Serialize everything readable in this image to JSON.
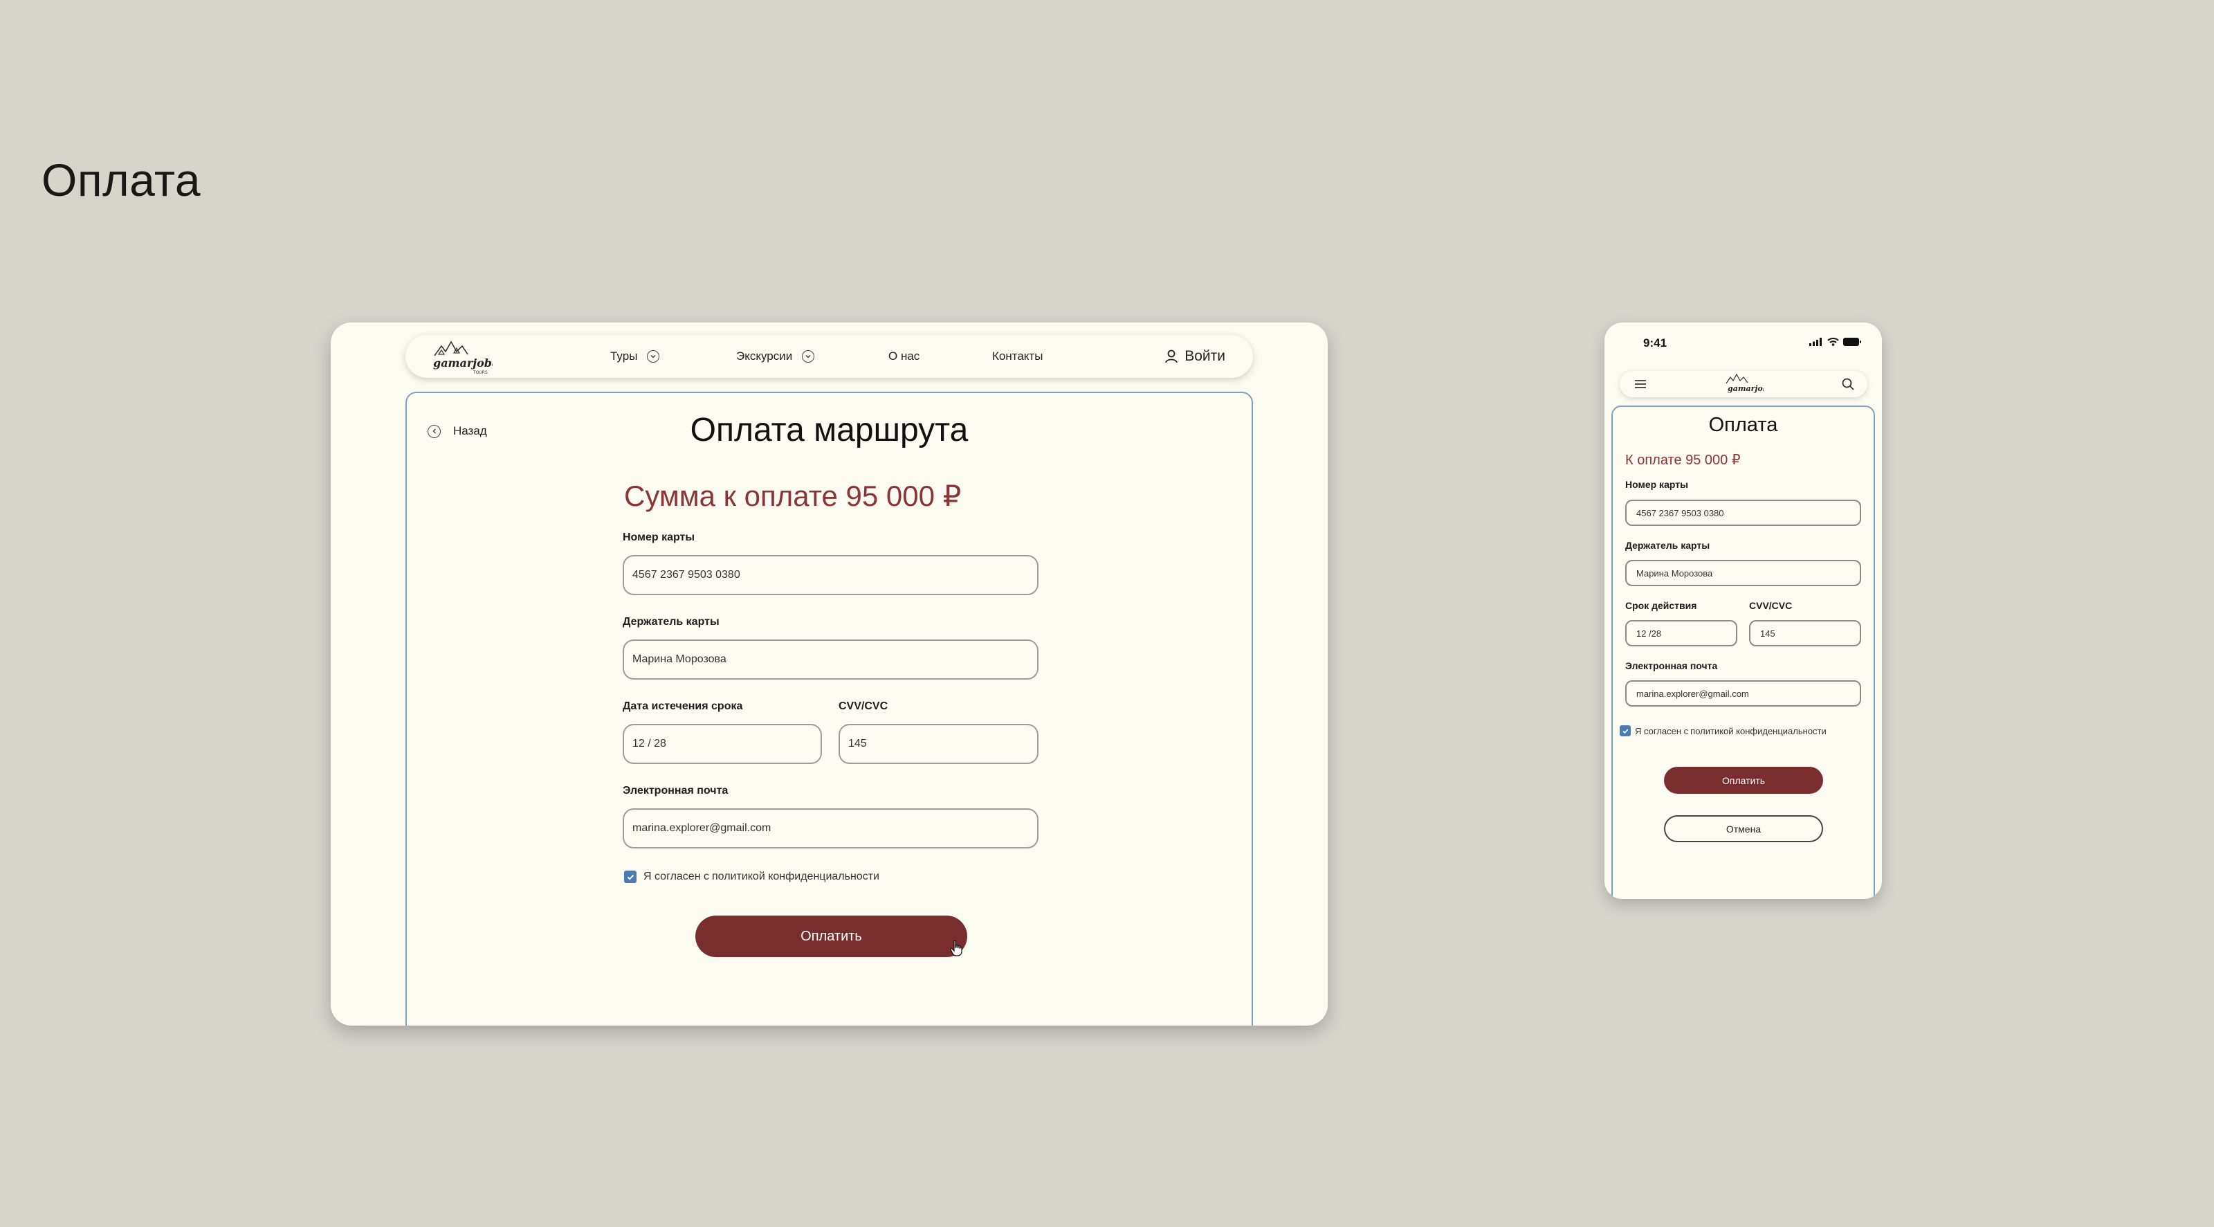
{
  "slide": {
    "title": "Оплата"
  },
  "desktop": {
    "nav": {
      "logo_text": "gamarjoba",
      "logo_sub": "TOURS",
      "items": [
        "Туры",
        "Экскурсии",
        "О нас",
        "Контакты"
      ],
      "login": "Войти"
    },
    "back_label": "Назад",
    "title": "Оплата маршрута",
    "amount": "Сумма к оплате 95 000 ₽",
    "fields": {
      "card_number_label": "Номер карты",
      "card_number_value": "4567 2367 9503 0380",
      "holder_label": "Держатель карты",
      "holder_value": "Марина Морозова",
      "expiry_label": "Дата истечения срока",
      "expiry_value": "12 / 28",
      "cvv_label": "CVV/CVC",
      "cvv_value": "145",
      "email_label": "Электронная почта",
      "email_value": "marina.explorer@gmail.com"
    },
    "agree_prefix": "Я согласен с",
    "agree_link": "политикой конфиденциальности",
    "agree_checked": true,
    "pay_button": "Оплатить"
  },
  "mobile": {
    "status_time": "9:41",
    "logo_text": "gamarjoba",
    "title": "Оплата",
    "amount": "К оплате 95 000 ₽",
    "fields": {
      "card_number_label": "Номер карты",
      "card_number_value": "4567 2367 9503 0380",
      "holder_label": "Держатель карты",
      "holder_value": "Марина Морозова",
      "expiry_label": "Срок действия",
      "expiry_value": "12 /28",
      "cvv_label": "CVV/CVC",
      "cvv_value": "145",
      "email_label": "Электронная почта",
      "email_value": "marina.explorer@gmail.com"
    },
    "agree_prefix": "Я согласен с",
    "agree_link": "политикой конфиденциальности",
    "agree_checked": true,
    "pay_button": "Оплатить",
    "cancel_button": "Отмена"
  },
  "colors": {
    "background": "#d7d4cc",
    "card": "#fcfbf1",
    "accent": "#7a2d2d",
    "amount": "#8a3436",
    "border_blue": "#7fa1c4",
    "checkbox": "#4c7ab3"
  },
  "icons": [
    "logo-icon",
    "chevron-down-icon",
    "user-icon",
    "back-arrow-icon",
    "checkbox-check-icon",
    "cursor-hand-icon",
    "hamburger-menu-icon",
    "search-icon",
    "signal-icon",
    "wifi-icon",
    "battery-icon"
  ]
}
